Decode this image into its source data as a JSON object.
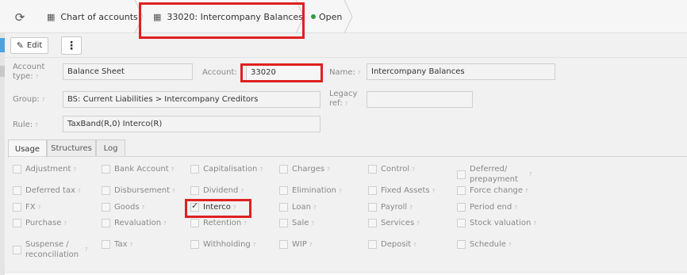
{
  "breadcrumb": {
    "chart_label": "Chart of accounts",
    "account_label": "33020: Intercompany Balances",
    "status_label": "Open",
    "status_color": "#2e9b45"
  },
  "toolbar": {
    "edit_label": "Edit",
    "more_label": "⋮"
  },
  "form": {
    "account_type": {
      "label": "Account type:",
      "value": "Balance Sheet"
    },
    "account": {
      "label": "Account:",
      "value": "33020"
    },
    "name": {
      "label": "Name:",
      "value": "Intercompany Balances"
    },
    "group": {
      "label": "Group:",
      "value": "BS: Current Liabilities > Intercompany Creditors"
    },
    "legacy_ref": {
      "label": "Legacy ref:",
      "value": ""
    },
    "rule": {
      "label": "Rule:",
      "value": "TaxBand(R,0) Interco(R)"
    }
  },
  "tabs": [
    {
      "label": "Usage",
      "active": true
    },
    {
      "label": "Structures",
      "active": false
    },
    {
      "label": "Log",
      "active": false
    }
  ],
  "usage": {
    "rows": [
      [
        {
          "label": "Adjustment",
          "checked": false
        },
        {
          "label": "Bank Account",
          "checked": false
        },
        {
          "label": "Capitalisation",
          "checked": false
        },
        {
          "label": "Charges",
          "checked": false
        },
        {
          "label": "Control",
          "checked": false
        },
        {
          "label": "Deferred/ prepayment",
          "checked": false
        }
      ],
      [
        {
          "label": "Deferred tax",
          "checked": false
        },
        {
          "label": "Disbursement",
          "checked": false
        },
        {
          "label": "Dividend",
          "checked": false
        },
        {
          "label": "Elimination",
          "checked": false
        },
        {
          "label": "Fixed Assets",
          "checked": false
        },
        {
          "label": "Force change",
          "checked": false
        }
      ],
      [
        {
          "label": "FX",
          "checked": false
        },
        {
          "label": "Goods",
          "checked": false
        },
        {
          "label": "Interco",
          "checked": true
        },
        {
          "label": "Loan",
          "checked": false
        },
        {
          "label": "Payroll",
          "checked": false
        },
        {
          "label": "Period end",
          "checked": false
        }
      ],
      [
        {
          "label": "Purchase",
          "checked": false
        },
        {
          "label": "Revaluation",
          "checked": false
        },
        {
          "label": "Retention",
          "checked": false
        },
        {
          "label": "Sale",
          "checked": false
        },
        {
          "label": "Services",
          "checked": false
        },
        {
          "label": "Stock valuation",
          "checked": false
        }
      ],
      [
        {
          "label": "Suspense / reconciliation",
          "checked": false
        },
        {
          "label": "Tax",
          "checked": false
        },
        {
          "label": "Withholding",
          "checked": false
        },
        {
          "label": "WIP",
          "checked": false
        },
        {
          "label": "Deposit",
          "checked": false
        },
        {
          "label": "Schedule",
          "checked": false
        }
      ]
    ]
  },
  "highlight_color": "#e02020"
}
